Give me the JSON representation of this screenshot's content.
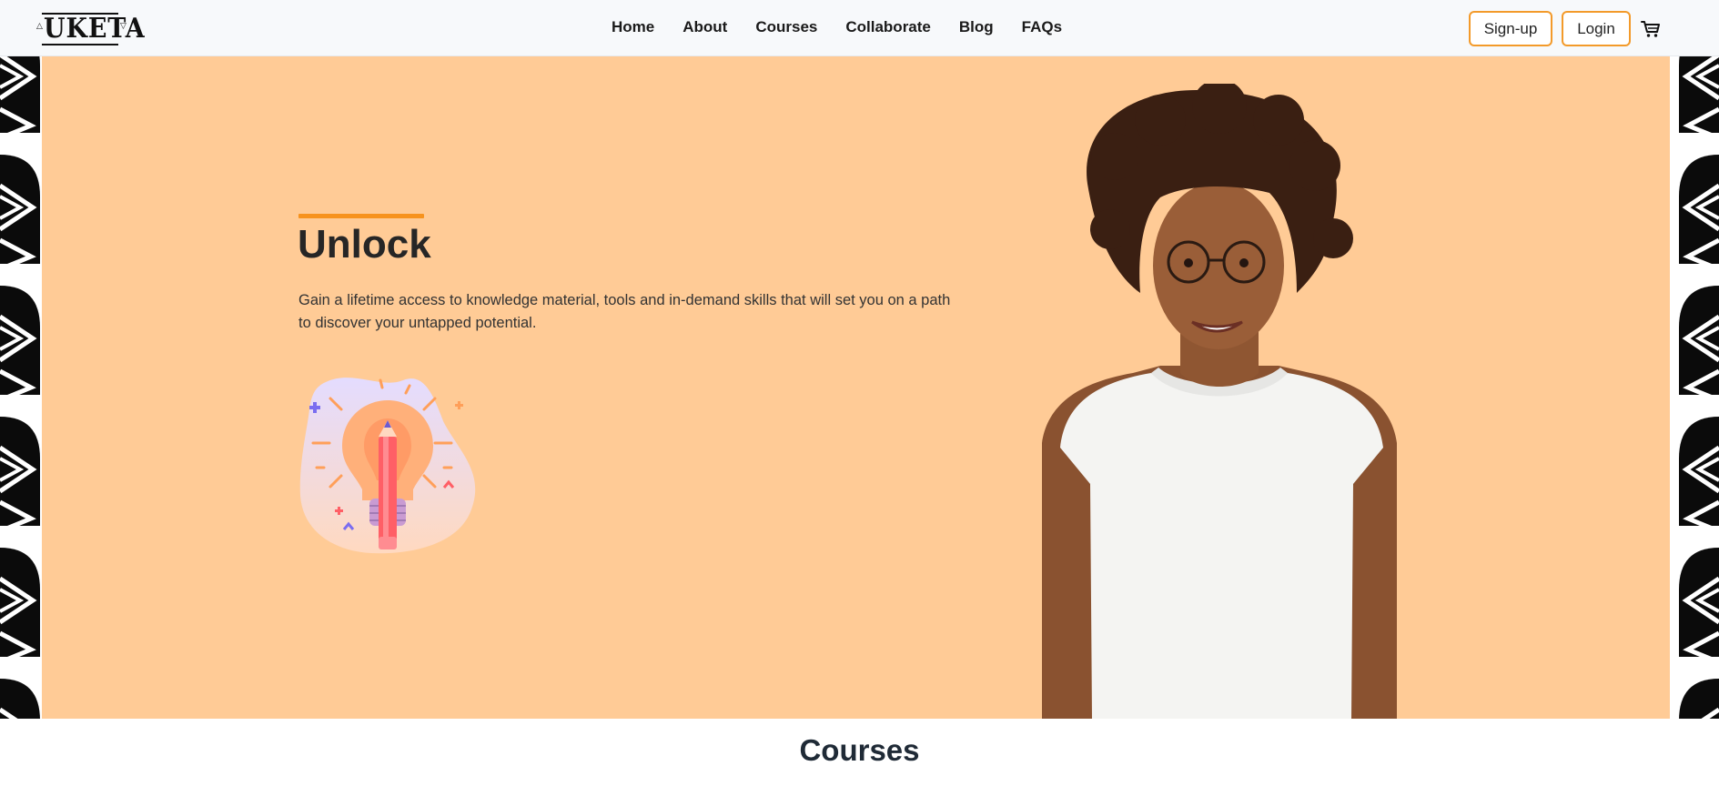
{
  "brand": {
    "name": "UKETA"
  },
  "nav": {
    "links": [
      "Home",
      "About",
      "Courses",
      "Collaborate",
      "Blog",
      "FAQs"
    ],
    "signup_label": "Sign-up",
    "login_label": "Login"
  },
  "hero": {
    "title": "Unlock",
    "description": "Gain a lifetime access to knowledge material, tools and in-demand skills that will set you on a path to discover your untapped potential."
  },
  "courses": {
    "title": "Courses"
  },
  "colors": {
    "hero_bg": "#ffcb96",
    "accent": "#f7931e",
    "button_border": "#f39a2a",
    "navbar_bg": "#f7f9fb",
    "text_dark": "#262626"
  },
  "icons": [
    "cart-icon",
    "lightbulb-pencil-icon"
  ]
}
